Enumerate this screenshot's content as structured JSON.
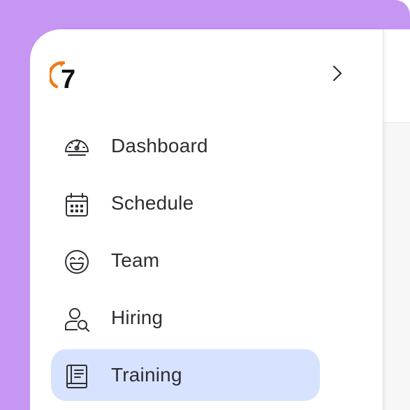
{
  "app": {
    "logo_text": "7",
    "accent_color": "#f07a17",
    "frame_color": "#c597f3"
  },
  "sidebar": {
    "expand_icon": "chevron-right-icon",
    "items": [
      {
        "label": "Dashboard",
        "icon": "gauge-icon",
        "active": false
      },
      {
        "label": "Schedule",
        "icon": "calendar-icon",
        "active": false
      },
      {
        "label": "Team",
        "icon": "smiley-icon",
        "active": false
      },
      {
        "label": "Hiring",
        "icon": "user-search-icon",
        "active": false
      },
      {
        "label": "Training",
        "icon": "book-icon",
        "active": true
      }
    ],
    "active_color": "#d7e3fe"
  }
}
